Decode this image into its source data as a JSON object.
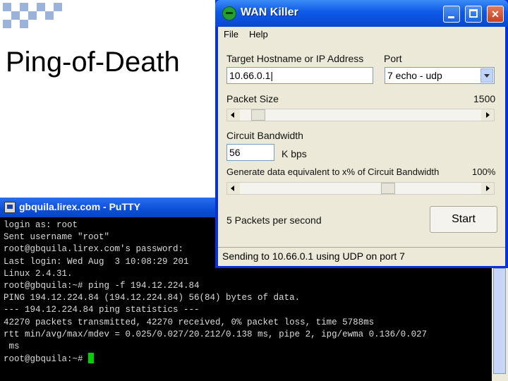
{
  "slide": {
    "title": "Ping-of-Death"
  },
  "wan_killer": {
    "window_title": "WAN Killer",
    "menu": [
      "File",
      "Help"
    ],
    "target_label": "Target Hostname or IP Address",
    "target_value": "10.66.0.1",
    "port_label": "Port",
    "port_value": "7 echo - udp",
    "packet_size_label": "Packet Size",
    "packet_size_value": "1500",
    "packet_size_fraction": 0.05,
    "bandwidth_label": "Circuit Bandwidth",
    "bandwidth_value": "56",
    "bandwidth_unit": "K bps",
    "generate_label": "Generate data equivalent to x% of Circuit Bandwidth",
    "generate_value": "100%",
    "generate_fraction": 0.62,
    "packets_per_second": "5 Packets per second",
    "start_label": "Start",
    "status": "Sending to 10.66.0.1 using UDP on port 7"
  },
  "putty": {
    "window_title": "gbquila.lirex.com - PuTTY",
    "lines": [
      "login as: root",
      "Sent username \"root\"",
      "root@gbquila.lirex.com's password:",
      "Last login: Wed Aug  3 10:08:29 201",
      "Linux 2.4.31.",
      "root@gbquila:~# ping -f 194.12.224.84",
      "PING 194.12.224.84 (194.12.224.84) 56(84) bytes of data.",
      "",
      "--- 194.12.224.84 ping statistics ---",
      "42270 packets transmitted, 42270 received, 0% packet loss, time 5788ms",
      "rtt min/avg/max/mdev = 0.025/0.027/20.212/0.138 ms, pipe 2, ipg/ewma 0.136/0.027",
      " ms"
    ],
    "prompt": "root@gbquila:~# "
  }
}
